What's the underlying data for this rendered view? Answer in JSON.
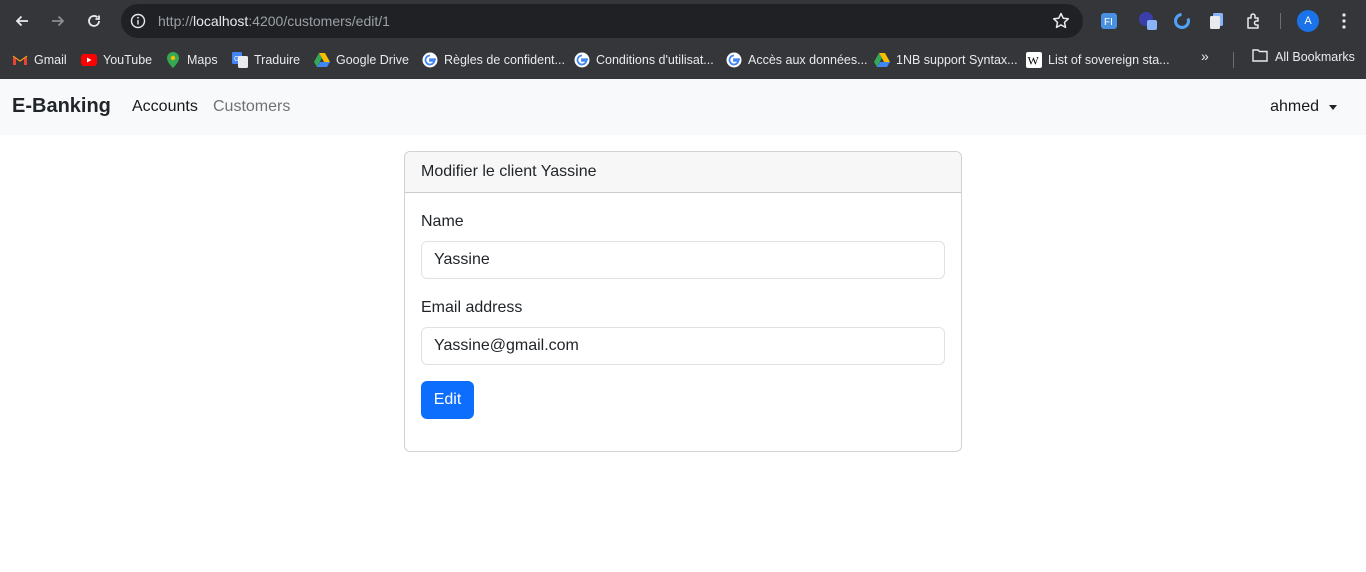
{
  "browser": {
    "url_prefix": "http://",
    "url_host": "localhost",
    "url_rest": ":4200/customers/edit/1",
    "profile_initial": "A",
    "bookmarks": [
      {
        "label": "Gmail",
        "icon": "gmail-icon"
      },
      {
        "label": "YouTube",
        "icon": "youtube-icon"
      },
      {
        "label": "Maps",
        "icon": "maps-icon"
      },
      {
        "label": "Traduire",
        "icon": "translate-icon"
      },
      {
        "label": "Google Drive",
        "icon": "drive-icon"
      },
      {
        "label": "Règles de confident...",
        "icon": "google-icon"
      },
      {
        "label": "Conditions d'utilisat...",
        "icon": "google-icon"
      },
      {
        "label": "Accès aux données...",
        "icon": "google-icon"
      },
      {
        "label": "1NB support Syntax...",
        "icon": "drive-icon"
      },
      {
        "label": "List of sovereign sta...",
        "icon": "wikipedia-icon"
      }
    ],
    "more_bookmarks": "»",
    "all_bookmarks": "All Bookmarks"
  },
  "navbar": {
    "brand": "E-Banking",
    "links": [
      "Accounts",
      "Customers"
    ],
    "user": "ahmed"
  },
  "card": {
    "title": "Modifier le client Yassine",
    "name_label": "Name",
    "name_value": "Yassine",
    "email_label": "Email address",
    "email_value": "Yassine@gmail.com",
    "submit_label": "Edit"
  },
  "colors": {
    "primary": "#0d6efd",
    "navbar_bg": "#f8f9fa",
    "chrome_bg": "#35363a"
  }
}
